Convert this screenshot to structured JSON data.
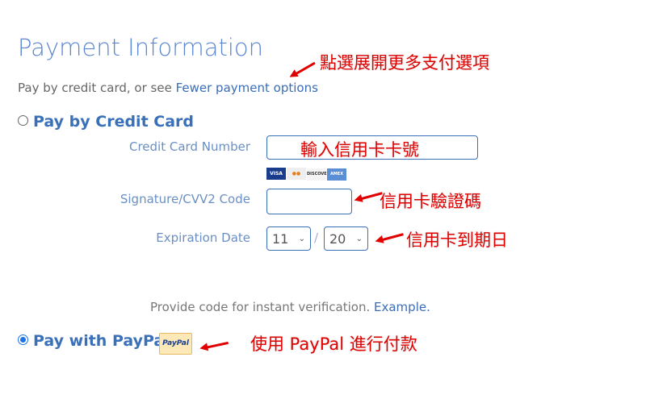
{
  "header": {
    "title": "Payment Information",
    "subtitle_prefix": "Pay by credit card, or see ",
    "subtitle_link": "Fewer payment options"
  },
  "credit_card": {
    "option_label": "Pay by Credit Card",
    "selected": false,
    "card_number_label": "Credit Card Number",
    "card_number_value": "",
    "cards": [
      "VISA",
      "MC",
      "DISCOVER",
      "AMEX"
    ],
    "cvv_label": "Signature/CVV2 Code",
    "cvv_value": "",
    "expiry_label": "Expiration Date",
    "expiry_month": "11",
    "expiry_separator": "/",
    "expiry_year": "20"
  },
  "verification": {
    "text": "Provide code for instant verification. ",
    "link": "Example."
  },
  "paypal": {
    "option_label": "Pay with PayPal",
    "selected": true,
    "logo_text": "PayPal"
  },
  "annotations": {
    "options": "點選展開更多支付選項",
    "card_number": "輸入信用卡卡號",
    "cvv": "信用卡驗證碼",
    "expiry": "信用卡到期日",
    "paypal": "使用 PayPal 進行付款"
  },
  "colors": {
    "accent": "#3a70b8",
    "annotation": "#e00000"
  }
}
